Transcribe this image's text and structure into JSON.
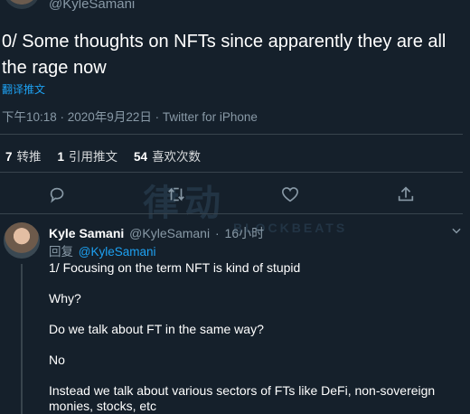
{
  "top": {
    "handle": "@KyleSamani"
  },
  "tweet": {
    "text": "0/ Some thoughts on NFTs since apparently they are all the rage now",
    "translate_label": "翻译推文",
    "meta": "下午10:18 · 2020年9月22日 · Twitter for iPhone"
  },
  "stats": [
    {
      "num": "7",
      "label": "转推"
    },
    {
      "num": "1",
      "label": "引用推文"
    },
    {
      "num": "54",
      "label": "喜欢次数"
    }
  ],
  "actions": [
    "reply-icon",
    "retweet-icon",
    "like-icon",
    "share-icon"
  ],
  "watermark": {
    "big": "律动",
    "small": "BLOCKBEATS"
  },
  "reply": {
    "name": "Kyle Samani",
    "handle": "@KyleSamani",
    "dot": "·",
    "time": "16小时",
    "replying_prefix": "回复",
    "replying_handle": "@KyleSamani",
    "paragraphs": [
      "1/ Focusing on the term NFT is kind of stupid",
      "Why?",
      "Do we talk about FT in the same way?",
      "No",
      "Instead we talk about various sectors of FTs like DeFi, non-sovereign monies, stocks, etc"
    ]
  },
  "colors": {
    "background": "#15202b",
    "accent": "#1da1f2",
    "muted": "#8899a6",
    "divider": "#38444d"
  }
}
